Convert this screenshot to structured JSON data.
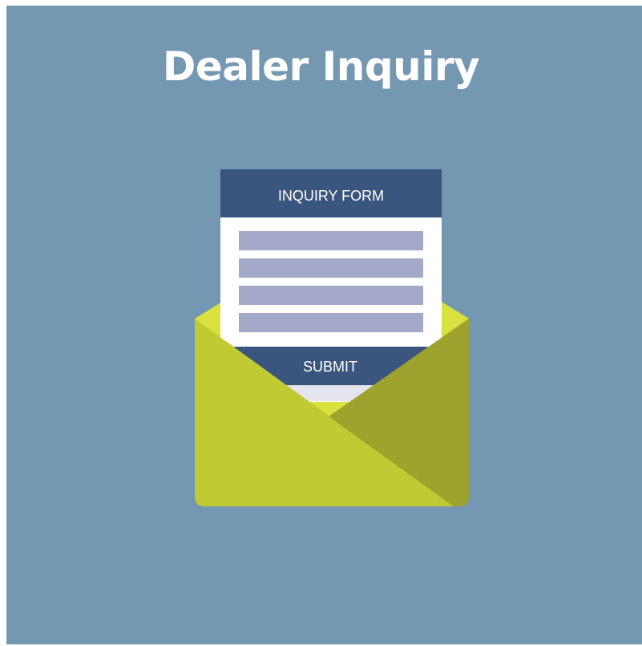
{
  "title": "Dealer Inquiry",
  "form": {
    "header": "INQUIRY FORM",
    "field_count": 4,
    "submit_label": "SUBMIT"
  },
  "colors": {
    "background": "#7497b2",
    "form_navy": "#3a567e",
    "field_lavender": "#a5a9c9",
    "envelope_light": "#c0cb33",
    "envelope_dark": "#9ea32e",
    "envelope_flap": "#d7df3e",
    "title_text": "#ffffff"
  },
  "icons": {
    "envelope": "open-envelope-icon",
    "form": "inquiry-form-icon"
  }
}
